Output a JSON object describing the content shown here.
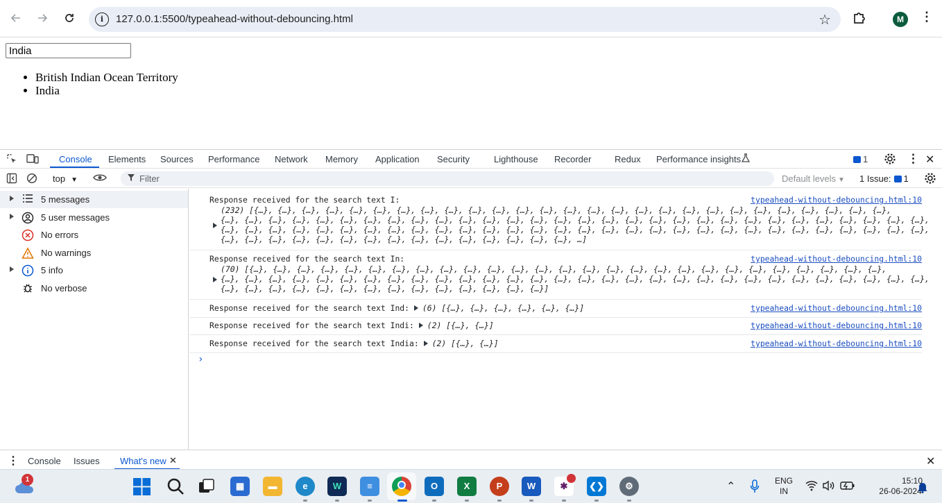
{
  "browser": {
    "url": "127.0.0.1:5500/typeahead-without-debouncing.html",
    "avatar_letter": "M"
  },
  "page": {
    "search_value": "India",
    "results": [
      "British Indian Ocean Territory",
      "India"
    ]
  },
  "devtools": {
    "tabs": [
      "Console",
      "Elements",
      "Sources",
      "Performance",
      "Network",
      "Memory",
      "Application",
      "Security",
      "Lighthouse",
      "Recorder",
      "Redux",
      "Performance insights"
    ],
    "issue_count": "1",
    "context": "top",
    "filter_placeholder": "Filter",
    "default_levels": "Default levels",
    "issues_label": "1 Issue:",
    "issues_count_2": "1",
    "sidebar": [
      {
        "label": "5 messages",
        "icon": "list-icon",
        "expandable": true
      },
      {
        "label": "5 user messages",
        "icon": "user-icon",
        "expandable": true
      },
      {
        "label": "No errors",
        "icon": "error-icon",
        "expandable": false
      },
      {
        "label": "No warnings",
        "icon": "warning-icon",
        "expandable": false
      },
      {
        "label": "5 info",
        "icon": "info-icon",
        "expandable": true
      },
      {
        "label": "No verbose",
        "icon": "bug-icon",
        "expandable": false
      }
    ],
    "logs": [
      {
        "text": "Response received for the search text I:",
        "detail": [
          "(232) [{…}, {…}, {…}, {…}, {…}, {…}, {…}, {…}, {…}, {…}, {…}, {…}, {…}, {…}, {…}, {…}, {…}, {…}, {…}, {…}, {…}, {…}, {…}, {…}, {…}, {…}, {…},",
          "{…}, {…}, {…}, {…}, {…}, {…}, {…}, {…}, {…}, {…}, {…}, {…}, {…}, {…}, {…}, {…}, {…}, {…}, {…}, {…}, {…}, {…}, {…}, {…}, {…}, {…}, {…}, {…}, {…}, {…},",
          "{…}, {…}, {…}, {…}, {…}, {…}, {…}, {…}, {…}, {…}, {…}, {…}, {…}, {…}, {…}, {…}, {…}, {…}, {…}, {…}, {…}, {…}, {…}, {…}, {…}, {…}, {…}, {…}, {…}, {…},",
          "{…}, {…}, {…}, {…}, {…}, {…}, {…}, {…}, {…}, {…}, {…}, {…}, {…}, {…}, {…}, …]"
        ],
        "source": "typeahead-without-debouncing.html:10"
      },
      {
        "text": "Response received for the search text In:",
        "detail": [
          "(70) [{…}, {…}, {…}, {…}, {…}, {…}, {…}, {…}, {…}, {…}, {…}, {…}, {…}, {…}, {…}, {…}, {…}, {…}, {…}, {…}, {…}, {…}, {…}, {…}, {…}, {…}, {…},",
          "{…}, {…}, {…}, {…}, {…}, {…}, {…}, {…}, {…}, {…}, {…}, {…}, {…}, {…}, {…}, {…}, {…}, {…}, {…}, {…}, {…}, {…}, {…}, {…}, {…}, {…}, {…}, {…}, {…}, {…},",
          "{…}, {…}, {…}, {…}, {…}, {…}, {…}, {…}, {…}, {…}, {…}, {…}, {…}, {…}]"
        ],
        "source": "typeahead-without-debouncing.html:10"
      },
      {
        "text": "Response received for the search text Ind:",
        "inline": "(6) [{…}, {…}, {…}, {…}, {…}, {…}]",
        "source": "typeahead-without-debouncing.html:10"
      },
      {
        "text": "Response received for the search text Indi:",
        "inline": "(2) [{…}, {…}]",
        "source": "typeahead-without-debouncing.html:10"
      },
      {
        "text": "Response received for the search text India:",
        "inline": "(2) [{…}, {…}]",
        "source": "typeahead-without-debouncing.html:10"
      }
    ],
    "drawer_tabs": [
      "Console",
      "Issues",
      "What's new"
    ]
  },
  "taskbar": {
    "weather_badge": "1",
    "lang_top": "ENG",
    "lang_bottom": "IN",
    "time": "15:10",
    "date": "26-06-2024"
  },
  "colors": {
    "accent": "#0b57d0",
    "link": "#1a4dc0",
    "error": "#d93025",
    "warning": "#e37400",
    "info": "#0b57d0"
  }
}
